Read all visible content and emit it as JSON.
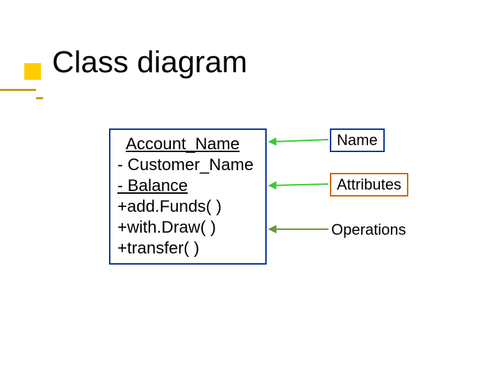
{
  "title": "Class diagram",
  "class_box": {
    "name": "Account_Name",
    "attributes": [
      "- Customer_Name",
      "- Balance"
    ],
    "operations": [
      "+add.Funds( )",
      "+with.Draw( )",
      "+transfer( )"
    ]
  },
  "labels": {
    "name": "Name",
    "attributes": "Attributes",
    "operations": "Operations"
  },
  "colors": {
    "box_border": "#003399",
    "accent": "#cc6600",
    "arrow": "#33cc33",
    "arrow2": "#669933",
    "bullet": "#ffcc00"
  }
}
